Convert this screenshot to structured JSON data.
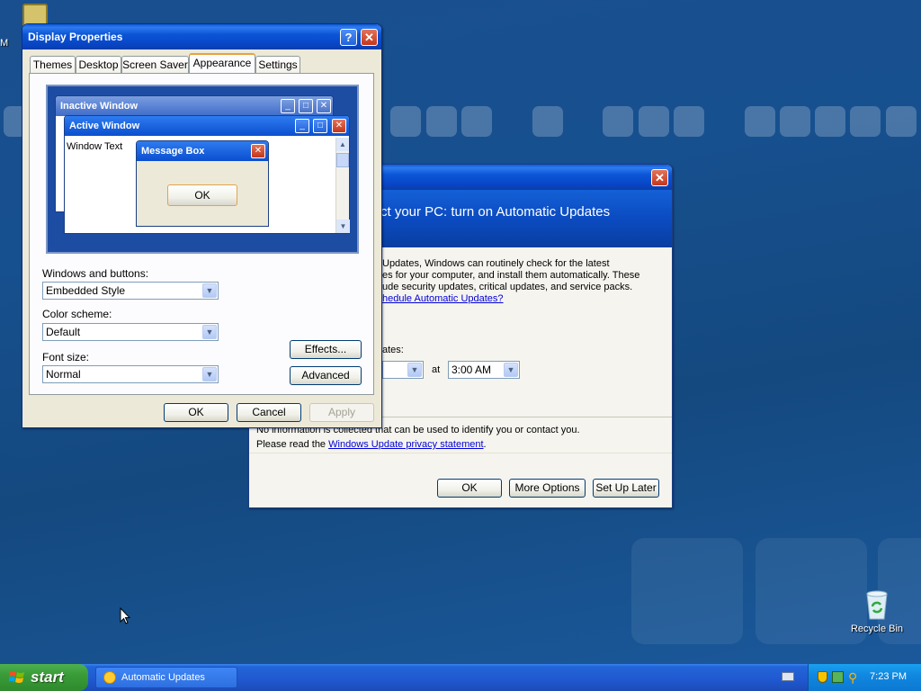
{
  "desktop": {
    "icons": {
      "top_left_label": "M",
      "recycle_bin": "Recycle Bin"
    }
  },
  "display_properties": {
    "title": "Display Properties",
    "tabs": [
      "Themes",
      "Desktop",
      "Screen Saver",
      "Appearance",
      "Settings"
    ],
    "active_tab": "Appearance",
    "preview": {
      "inactive_window": "Inactive Window",
      "active_window": "Active Window",
      "window_text": "Window Text",
      "message_box": "Message Box",
      "ok": "OK"
    },
    "windows_and_buttons": {
      "label": "Windows and buttons:",
      "value": "Embedded Style"
    },
    "color_scheme": {
      "label": "Color scheme:",
      "value": "Default"
    },
    "font_size": {
      "label": "Font size:",
      "value": "Normal"
    },
    "effects_button": "Effects...",
    "advanced_button": "Advanced",
    "ok_button": "OK",
    "cancel_button": "Cancel",
    "apply_button": "Apply"
  },
  "automatic_updates": {
    "title": "",
    "banner": "ct your PC: turn on Automatic Updates",
    "body_lines": [
      "Updates, Windows can routinely check for the latest",
      "es for your computer, and install them automatically. These",
      "ude security updates, critical updates, and service packs."
    ],
    "schedule_link": "hedule Automatic Updates?",
    "schedule_label": "ates:",
    "at_label": "at",
    "time_value": "3:00 AM",
    "privacy_line": "No information is collected that can be used to identify you or contact you.",
    "privacy_prefix": "Please read the ",
    "privacy_link": "Windows Update privacy statement",
    "privacy_suffix": ".",
    "ok_button": "OK",
    "more_options_button": "More Options",
    "set_up_later_button": "Set Up Later"
  },
  "taskbar": {
    "start": "start",
    "task_item": "Automatic Updates",
    "clock": "7:23 PM"
  }
}
